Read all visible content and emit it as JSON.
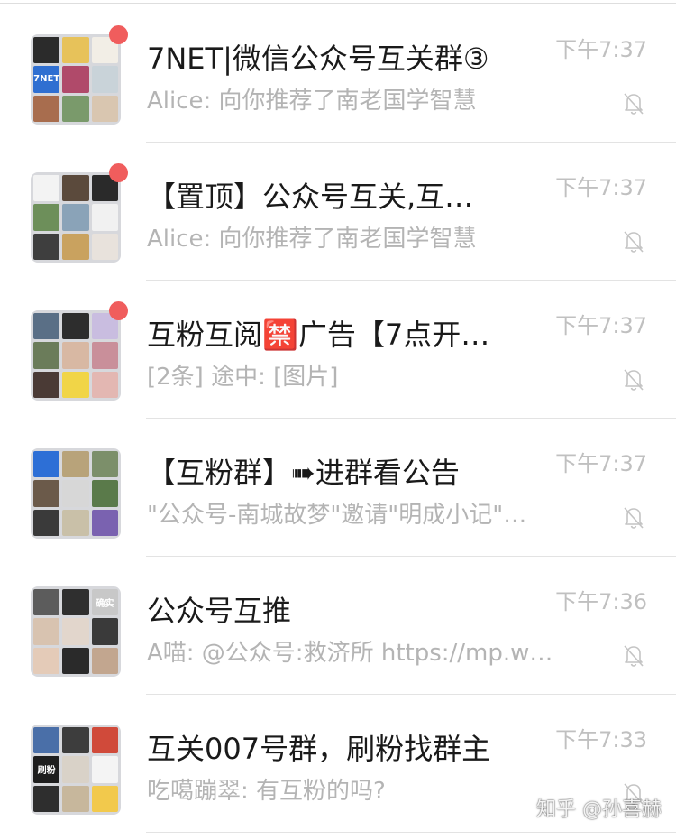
{
  "chats": [
    {
      "title": "7NET|微信公众号互关群③",
      "preview": "Alice: 向你推荐了南老国学智慧",
      "time": "下午7:37",
      "unread_dot": true,
      "muted": true,
      "avatar_tile_colors": [
        "#2b2b2b",
        "#e7c25a",
        "#f2eee6",
        "#2f6fd1",
        "#b04a6a",
        "#c9d3d9",
        "#a86d4e",
        "#7a9a6b",
        "#d9c6b0"
      ]
    },
    {
      "title": "【置顶】公众号互关,互…",
      "preview": "Alice: 向你推荐了南老国学智慧",
      "time": "下午7:37",
      "unread_dot": true,
      "muted": true,
      "avatar_tile_colors": [
        "#f3f3f3",
        "#5b4a3c",
        "#2a2a2a",
        "#6d8f5a",
        "#8aa3b8",
        "#f1f1f1",
        "#3e3e3e",
        "#c9a25f",
        "#e8e2dc"
      ]
    },
    {
      "title": "互粉互阅🈲广告【7点开…",
      "preview": "[2条] 途中: [图片]",
      "time": "下午7:37",
      "unread_dot": true,
      "muted": true,
      "avatar_tile_colors": [
        "#5a6f86",
        "#2d2d2d",
        "#c9bde0",
        "#6b7c5a",
        "#d8b8a3",
        "#c98f9a",
        "#4a3a35",
        "#f1d547",
        "#e3b7b2"
      ]
    },
    {
      "title": "【互粉群】➠进群看公告",
      "preview": "\"公众号-南城故梦\"邀请\"明成小记\"…",
      "time": "下午7:37",
      "unread_dot": false,
      "muted": true,
      "avatar_tile_colors": [
        "#2d6fd6",
        "#b8a37a",
        "#7c8f6a",
        "#6b5a4a",
        "#d7d7d7",
        "#5a7a4a",
        "#3a3a3a",
        "#c9c0a8",
        "#7a62b0"
      ]
    },
    {
      "title": "公众号互推",
      "preview": "A喵: @公众号:救济所 https://mp.w…",
      "time": "下午7:36",
      "unread_dot": false,
      "muted": true,
      "avatar_tile_colors": [
        "#5c5c5c",
        "#2f2f2f",
        "#c8c8c8",
        "#d8c3b0",
        "#e2d6cc",
        "#3a3a3a",
        "#e4cbb8",
        "#2a2a2a",
        "#c2a68f"
      ]
    },
    {
      "title": "互关007号群，刷粉找群主",
      "preview": "吃噶蹦翠: 有互粉的吗?",
      "time": "下午7:33",
      "unread_dot": false,
      "muted": true,
      "avatar_tile_colors": [
        "#4a6fa8",
        "#3d3d3d",
        "#d04a3a",
        "#1e1e1e",
        "#d9d2c8",
        "#f4f4f4",
        "#2e2e2e",
        "#c7b79c",
        "#f2c94c"
      ]
    }
  ],
  "avatar_tile_labels": {
    "0": [
      "",
      "",
      "",
      "7NET",
      "",
      "",
      "",
      "",
      ""
    ],
    "4": [
      "",
      "",
      "确实",
      "",
      "",
      "",
      "",
      "",
      ""
    ],
    "5": [
      "",
      "",
      "",
      "刷粉",
      "",
      "",
      "",
      "",
      ""
    ]
  },
  "watermark": "知乎 @孙喜赫"
}
